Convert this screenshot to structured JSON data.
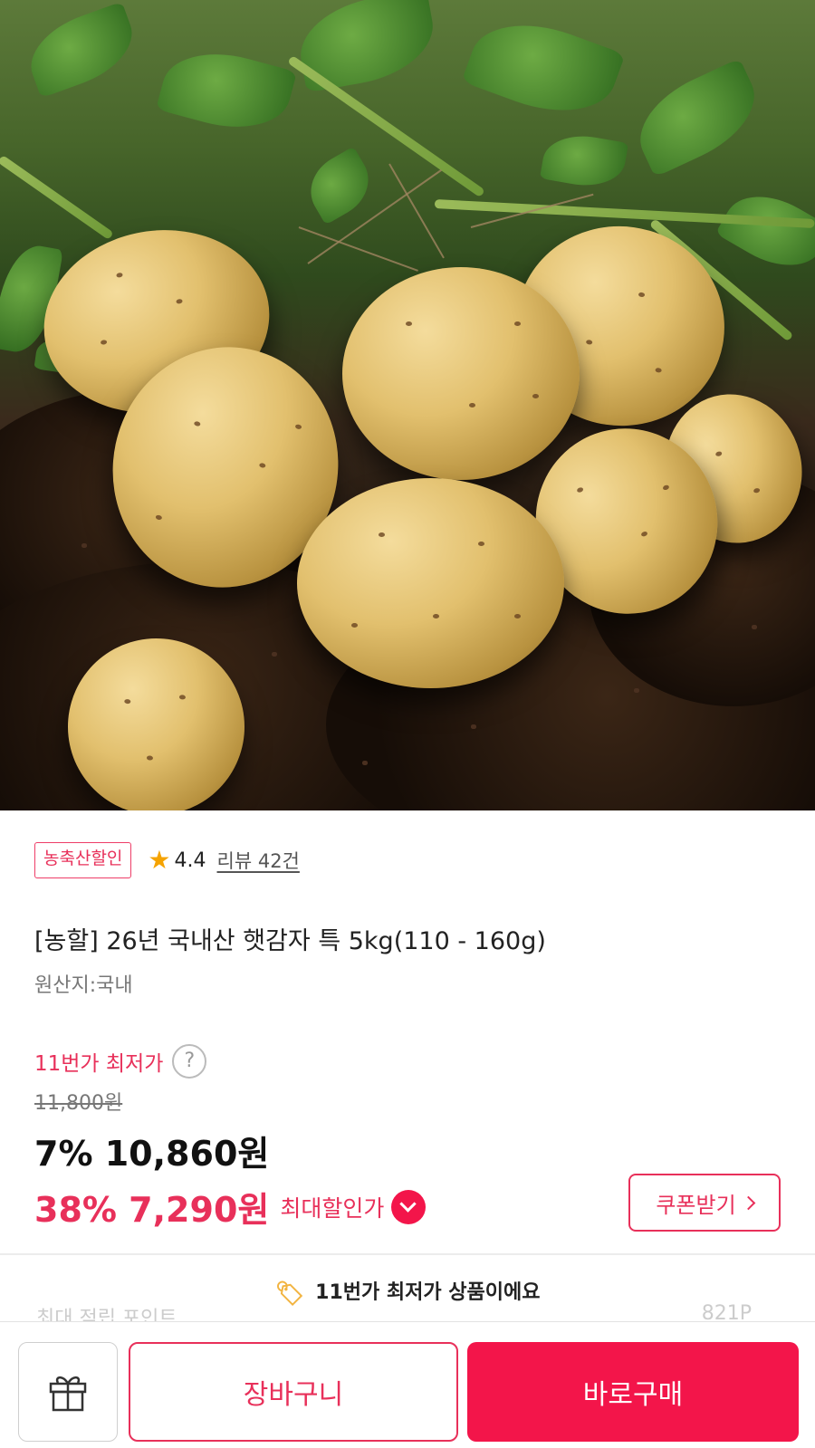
{
  "product": {
    "badge": "농축산할인",
    "rating": "4.4",
    "review_label": "리뷰 42건",
    "title": "[농할] 26년 국내산 햇감자 특 5kg(110 - 160g)",
    "origin": "원산지:국내"
  },
  "pricing": {
    "lowest_label": "11번가 최저가",
    "help_glyph": "?",
    "original_price": "11,800원",
    "sale_price": "7% 10,860원",
    "max_price": "38% 7,290원",
    "max_label": "최대할인가",
    "coupon_label": "쿠폰받기"
  },
  "notice": {
    "text": "11번가 최저가 상품이에요",
    "icon": "price-tag-icon"
  },
  "partial_row": {
    "left": "최대 적립 포인트",
    "right": "821P"
  },
  "bottom_bar": {
    "cart_label": "장바구니",
    "buy_label": "바로구매",
    "gift_icon": "gift-icon"
  },
  "colors": {
    "accent": "#e8305a",
    "buy_button": "#f3154a",
    "star": "#f5a300"
  }
}
